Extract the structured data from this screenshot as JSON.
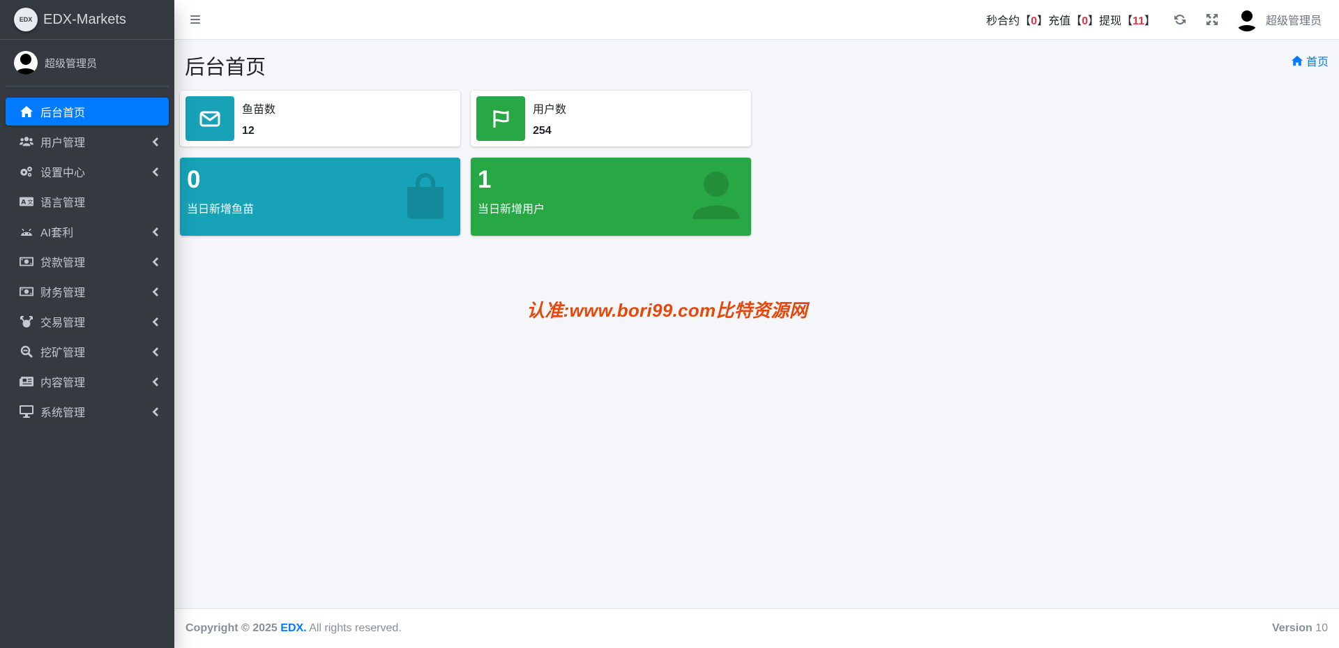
{
  "brand": {
    "logo_text": "EDX",
    "name": "EDX-Markets"
  },
  "user": {
    "name": "超级管理员"
  },
  "sidebar": {
    "items": [
      {
        "label": "后台首页",
        "icon": "home-icon",
        "active": true,
        "has_children": false
      },
      {
        "label": "用户管理",
        "icon": "users-icon",
        "has_children": true
      },
      {
        "label": "设置中心",
        "icon": "cogs-icon",
        "has_children": true
      },
      {
        "label": "语言管理",
        "icon": "language-icon",
        "has_children": false
      },
      {
        "label": "AI套利",
        "icon": "android-icon",
        "has_children": true
      },
      {
        "label": "贷款管理",
        "icon": "money-bill-icon",
        "has_children": true
      },
      {
        "label": "财务管理",
        "icon": "money-bill-icon",
        "has_children": true
      },
      {
        "label": "交易管理",
        "icon": "exchange-icon",
        "has_children": true
      },
      {
        "label": "挖矿管理",
        "icon": "search-minus-icon",
        "has_children": true
      },
      {
        "label": "内容管理",
        "icon": "newspaper-icon",
        "has_children": true
      },
      {
        "label": "系统管理",
        "icon": "desktop-icon",
        "has_children": true
      }
    ]
  },
  "header": {
    "stats": {
      "contract_label": "秒合约",
      "contract_value": "0",
      "recharge_label": "充值",
      "recharge_value": "0",
      "withdraw_label": "提现",
      "withdraw_value": "11",
      "open_bracket": "【",
      "close_bracket": "】"
    },
    "user_name": "超级管理员"
  },
  "page": {
    "title": "后台首页",
    "breadcrumb": "首页"
  },
  "info_boxes": [
    {
      "label": "鱼苗数",
      "value": "12",
      "icon": "envelope-icon",
      "color": "#17a2b8"
    },
    {
      "label": "用户数",
      "value": "254",
      "icon": "flag-icon",
      "color": "#28a745"
    }
  ],
  "small_boxes": [
    {
      "value": "0",
      "label": "当日新增鱼苗",
      "icon": "shopping-bag-icon",
      "color": "#17a2b8"
    },
    {
      "value": "1",
      "label": "当日新增用户",
      "icon": "user-icon",
      "color": "#28a745"
    }
  ],
  "watermark": "认准:www.bori99.com比特资源网",
  "footer": {
    "copyright_prefix": "Copyright © 2025",
    "brand": "EDX.",
    "rights": "All rights reserved.",
    "version_label": "Version",
    "version_value": "10"
  }
}
